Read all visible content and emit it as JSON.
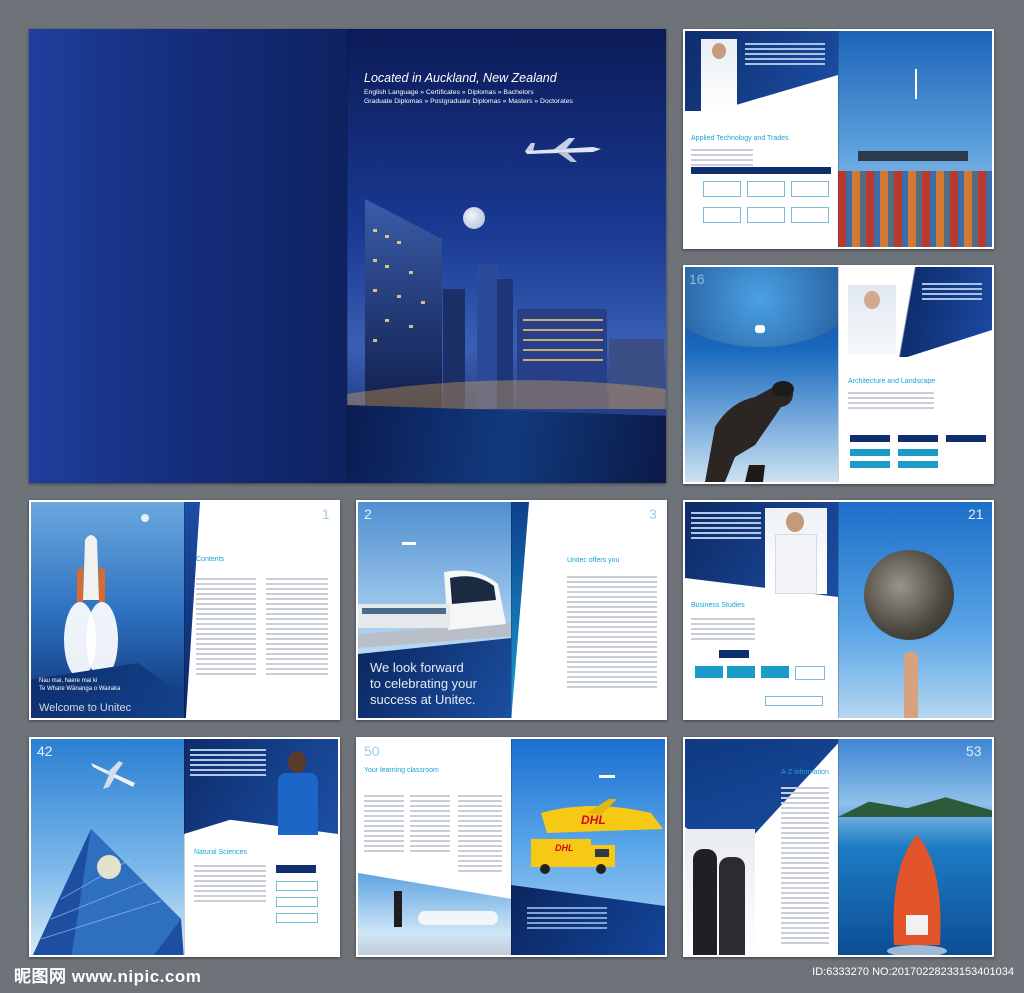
{
  "cover": {
    "title": "Located in Auckland, New Zealand",
    "line1": "English Language » Certificates » Diplomas » Bachelors",
    "line2": "Graduate Diplomas » Postgraduate Diplomas » Masters » Doctorates"
  },
  "spread_applied": {
    "heading": "Applied Technology and Trades"
  },
  "spread_architecture": {
    "heading": "Architecture and Landscape",
    "page_number": "16"
  },
  "spread_contents": {
    "page_number": "1",
    "heading": "Contents",
    "tagline_1": "Nau mai, haere mai ki",
    "tagline_2": "Te Whare Wānanga o Wairaka",
    "tagline_3": "Welcome to Unitec"
  },
  "spread_offers": {
    "page_left": "2",
    "page_right": "3",
    "heading": "Unitec offers you",
    "cta_1": "We look forward",
    "cta_2": "to celebrating your",
    "cta_3": "success at Unitec."
  },
  "spread_business": {
    "heading": "Business Studies",
    "page_number": "21"
  },
  "spread_natural": {
    "heading": "Natural Sciences",
    "page_number": "42"
  },
  "spread_classroom": {
    "heading": "Your learning classroom",
    "page_number": "50",
    "truck_logo": "DHL"
  },
  "spread_az": {
    "heading": "A-Z information",
    "page_number": "53"
  },
  "watermark": {
    "brand": "昵图网 www.nipic.com",
    "id": "ID:6333270 NO:20170228233153401034"
  }
}
